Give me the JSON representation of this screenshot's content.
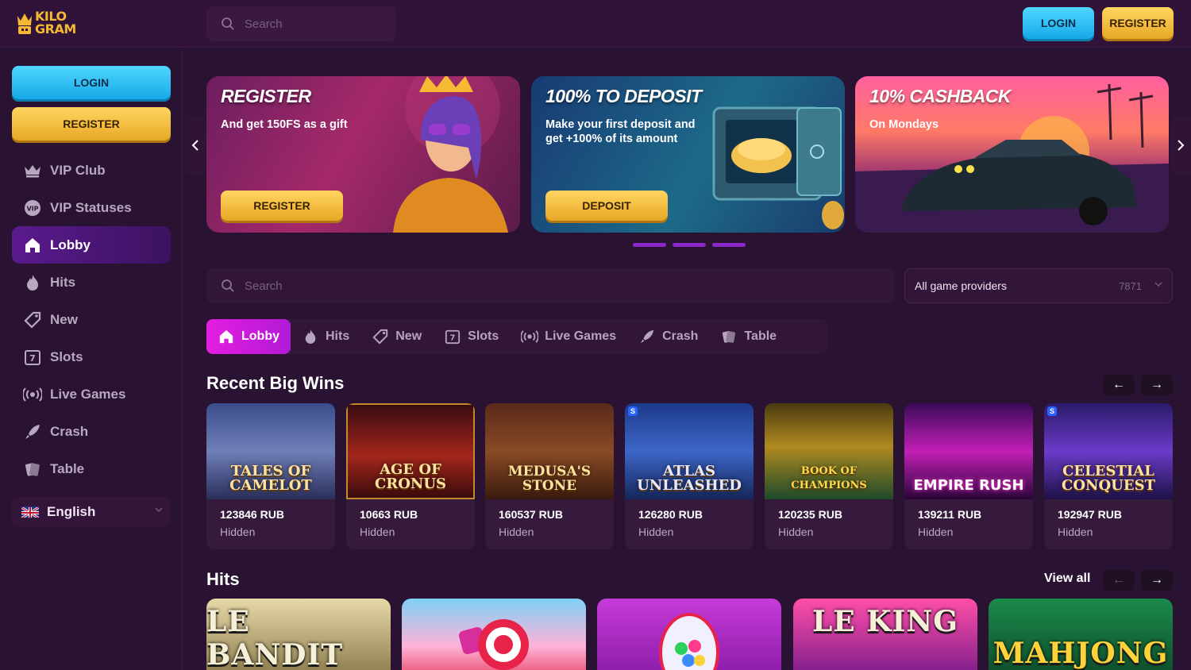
{
  "brand": {
    "logo_text_line1": "KiLO",
    "logo_text_line2": "GRAM",
    "accent": "#f5b934"
  },
  "topbar": {
    "search_placeholder": "Search",
    "login_label": "LOGIN",
    "register_label": "REGISTER"
  },
  "sidebar": {
    "login_label": "LOGIN",
    "register_label": "REGISTER",
    "items": [
      {
        "label": "VIP Club",
        "icon": "crown-icon"
      },
      {
        "label": "VIP Statuses",
        "icon": "vip-badge-icon"
      },
      {
        "label": "Lobby",
        "icon": "home-icon",
        "active": true
      },
      {
        "label": "Hits",
        "icon": "flame-icon"
      },
      {
        "label": "New",
        "icon": "tag-icon"
      },
      {
        "label": "Slots",
        "icon": "slot-machine-icon"
      },
      {
        "label": "Live Games",
        "icon": "broadcast-icon"
      },
      {
        "label": "Crash",
        "icon": "rocket-icon"
      },
      {
        "label": "Table",
        "icon": "cards-icon"
      }
    ],
    "language": "English"
  },
  "banners": [
    {
      "title": "REGISTER",
      "text": "And get 150FS as a gift",
      "button": "REGISTER"
    },
    {
      "title": "100% TO DEPOSIT",
      "text": "Make your first deposit and get +100% of its amount",
      "button": "DEPOSIT"
    },
    {
      "title": "10% CASHBACK",
      "text": "On Mondays"
    }
  ],
  "filters": {
    "search_placeholder": "Search",
    "providers_label": "All game providers",
    "providers_count": "7871"
  },
  "tabs": [
    {
      "label": "Lobby",
      "active": true
    },
    {
      "label": "Hits"
    },
    {
      "label": "New"
    },
    {
      "label": "Slots"
    },
    {
      "label": "Live Games"
    },
    {
      "label": "Crash"
    },
    {
      "label": "Table"
    }
  ],
  "big_wins": {
    "title": "Recent Big Wins",
    "items": [
      {
        "game": "TALES OF CAMELOT",
        "amount": "123846 RUB",
        "user": "Hidden"
      },
      {
        "game": "AGE OF CRONUS",
        "amount": "10663 RUB",
        "user": "Hidden"
      },
      {
        "game": "MEDUSA'S STONE",
        "amount": "160537 RUB",
        "user": "Hidden"
      },
      {
        "game": "ATLAS UNLEASHED",
        "amount": "126280 RUB",
        "user": "Hidden"
      },
      {
        "game": "BOOK OF CHAMPIONS",
        "amount": "120235 RUB",
        "user": "Hidden"
      },
      {
        "game": "EMPIRE RUSH",
        "amount": "139211 RUB",
        "user": "Hidden"
      },
      {
        "game": "CELESTIAL CONQUEST",
        "amount": "192947 RUB",
        "user": "Hidden"
      }
    ]
  },
  "hits": {
    "title": "Hits",
    "view_all": "View all",
    "items": [
      {
        "game": "LE BANDIT"
      },
      {
        "game": ""
      },
      {
        "game": ""
      },
      {
        "game": "LE KING"
      },
      {
        "game": "MAHJONG"
      }
    ]
  }
}
